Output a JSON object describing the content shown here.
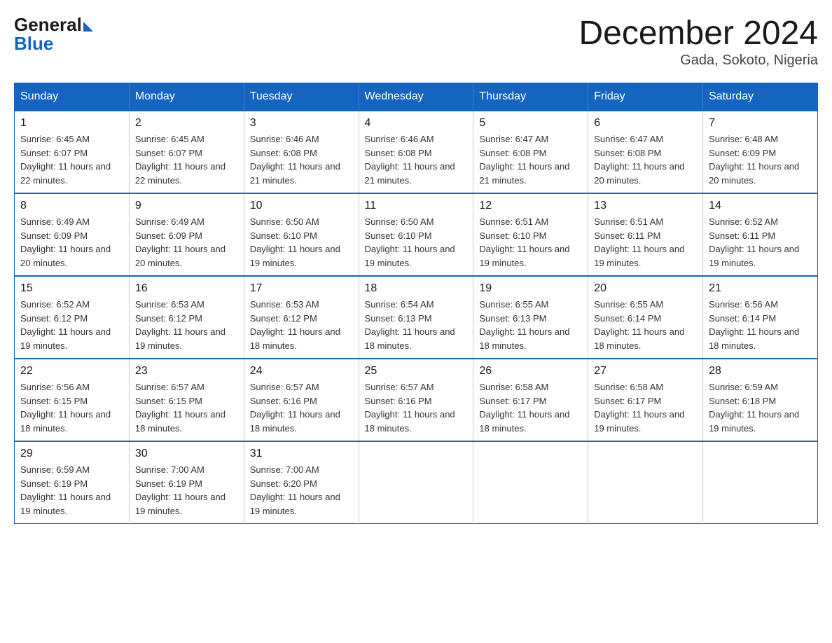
{
  "logo": {
    "general": "General",
    "blue": "Blue"
  },
  "title": "December 2024",
  "subtitle": "Gada, Sokoto, Nigeria",
  "days": [
    "Sunday",
    "Monday",
    "Tuesday",
    "Wednesday",
    "Thursday",
    "Friday",
    "Saturday"
  ],
  "weeks": [
    [
      {
        "date": "1",
        "sunrise": "6:45 AM",
        "sunset": "6:07 PM",
        "daylight": "11 hours and 22 minutes."
      },
      {
        "date": "2",
        "sunrise": "6:45 AM",
        "sunset": "6:07 PM",
        "daylight": "11 hours and 22 minutes."
      },
      {
        "date": "3",
        "sunrise": "6:46 AM",
        "sunset": "6:08 PM",
        "daylight": "11 hours and 21 minutes."
      },
      {
        "date": "4",
        "sunrise": "6:46 AM",
        "sunset": "6:08 PM",
        "daylight": "11 hours and 21 minutes."
      },
      {
        "date": "5",
        "sunrise": "6:47 AM",
        "sunset": "6:08 PM",
        "daylight": "11 hours and 21 minutes."
      },
      {
        "date": "6",
        "sunrise": "6:47 AM",
        "sunset": "6:08 PM",
        "daylight": "11 hours and 20 minutes."
      },
      {
        "date": "7",
        "sunrise": "6:48 AM",
        "sunset": "6:09 PM",
        "daylight": "11 hours and 20 minutes."
      }
    ],
    [
      {
        "date": "8",
        "sunrise": "6:49 AM",
        "sunset": "6:09 PM",
        "daylight": "11 hours and 20 minutes."
      },
      {
        "date": "9",
        "sunrise": "6:49 AM",
        "sunset": "6:09 PM",
        "daylight": "11 hours and 20 minutes."
      },
      {
        "date": "10",
        "sunrise": "6:50 AM",
        "sunset": "6:10 PM",
        "daylight": "11 hours and 19 minutes."
      },
      {
        "date": "11",
        "sunrise": "6:50 AM",
        "sunset": "6:10 PM",
        "daylight": "11 hours and 19 minutes."
      },
      {
        "date": "12",
        "sunrise": "6:51 AM",
        "sunset": "6:10 PM",
        "daylight": "11 hours and 19 minutes."
      },
      {
        "date": "13",
        "sunrise": "6:51 AM",
        "sunset": "6:11 PM",
        "daylight": "11 hours and 19 minutes."
      },
      {
        "date": "14",
        "sunrise": "6:52 AM",
        "sunset": "6:11 PM",
        "daylight": "11 hours and 19 minutes."
      }
    ],
    [
      {
        "date": "15",
        "sunrise": "6:52 AM",
        "sunset": "6:12 PM",
        "daylight": "11 hours and 19 minutes."
      },
      {
        "date": "16",
        "sunrise": "6:53 AM",
        "sunset": "6:12 PM",
        "daylight": "11 hours and 19 minutes."
      },
      {
        "date": "17",
        "sunrise": "6:53 AM",
        "sunset": "6:12 PM",
        "daylight": "11 hours and 18 minutes."
      },
      {
        "date": "18",
        "sunrise": "6:54 AM",
        "sunset": "6:13 PM",
        "daylight": "11 hours and 18 minutes."
      },
      {
        "date": "19",
        "sunrise": "6:55 AM",
        "sunset": "6:13 PM",
        "daylight": "11 hours and 18 minutes."
      },
      {
        "date": "20",
        "sunrise": "6:55 AM",
        "sunset": "6:14 PM",
        "daylight": "11 hours and 18 minutes."
      },
      {
        "date": "21",
        "sunrise": "6:56 AM",
        "sunset": "6:14 PM",
        "daylight": "11 hours and 18 minutes."
      }
    ],
    [
      {
        "date": "22",
        "sunrise": "6:56 AM",
        "sunset": "6:15 PM",
        "daylight": "11 hours and 18 minutes."
      },
      {
        "date": "23",
        "sunrise": "6:57 AM",
        "sunset": "6:15 PM",
        "daylight": "11 hours and 18 minutes."
      },
      {
        "date": "24",
        "sunrise": "6:57 AM",
        "sunset": "6:16 PM",
        "daylight": "11 hours and 18 minutes."
      },
      {
        "date": "25",
        "sunrise": "6:57 AM",
        "sunset": "6:16 PM",
        "daylight": "11 hours and 18 minutes."
      },
      {
        "date": "26",
        "sunrise": "6:58 AM",
        "sunset": "6:17 PM",
        "daylight": "11 hours and 18 minutes."
      },
      {
        "date": "27",
        "sunrise": "6:58 AM",
        "sunset": "6:17 PM",
        "daylight": "11 hours and 19 minutes."
      },
      {
        "date": "28",
        "sunrise": "6:59 AM",
        "sunset": "6:18 PM",
        "daylight": "11 hours and 19 minutes."
      }
    ],
    [
      {
        "date": "29",
        "sunrise": "6:59 AM",
        "sunset": "6:19 PM",
        "daylight": "11 hours and 19 minutes."
      },
      {
        "date": "30",
        "sunrise": "7:00 AM",
        "sunset": "6:19 PM",
        "daylight": "11 hours and 19 minutes."
      },
      {
        "date": "31",
        "sunrise": "7:00 AM",
        "sunset": "6:20 PM",
        "daylight": "11 hours and 19 minutes."
      },
      null,
      null,
      null,
      null
    ]
  ]
}
